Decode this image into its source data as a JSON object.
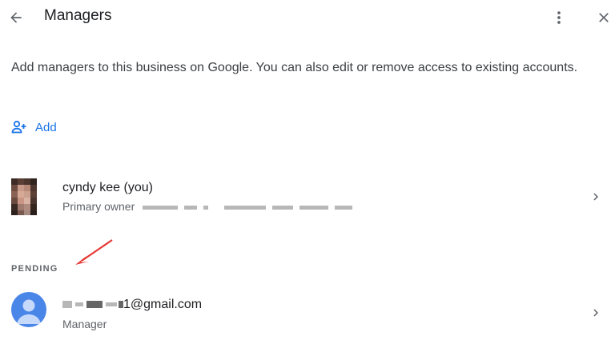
{
  "header": {
    "title": "Managers",
    "back_icon": "arrow-left-icon",
    "more_icon": "more-vert-icon",
    "close_icon": "close-icon"
  },
  "description": "Add managers to this business on Google. You can also edit or remove access to existing accounts.",
  "add_button": {
    "label": "Add",
    "icon": "person-add-icon"
  },
  "owner": {
    "name": "cyndy kee (you)",
    "role": "Primary owner",
    "email_redacted": true
  },
  "pending": {
    "section_label": "PENDING",
    "items": [
      {
        "email": "1@gmail.com",
        "role": "Manager"
      }
    ]
  },
  "colors": {
    "accent": "#1a73e8",
    "annotation_arrow": "#e53935",
    "avatar_blue": "#4a86e8"
  }
}
